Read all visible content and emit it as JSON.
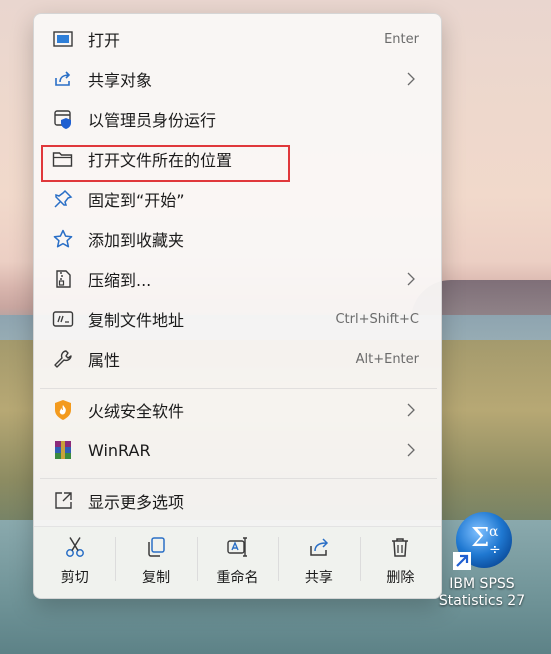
{
  "menu": {
    "items": [
      {
        "label": "打开",
        "shortcut": "Enter",
        "icon": "open-window-icon"
      },
      {
        "label": "共享对象",
        "icon": "share-icon",
        "submenu": true
      },
      {
        "label": "以管理员身份运行",
        "icon": "admin-shield-icon"
      },
      {
        "label": "打开文件所在的位置",
        "icon": "folder-icon",
        "highlighted": true
      },
      {
        "label": "固定到“开始”",
        "icon": "pin-icon"
      },
      {
        "label": "添加到收藏夹",
        "icon": "star-icon"
      },
      {
        "label": "压缩到...",
        "icon": "zip-icon",
        "submenu": true
      },
      {
        "label": "复制文件地址",
        "shortcut": "Ctrl+Shift+C",
        "icon": "copy-path-icon"
      },
      {
        "label": "属性",
        "shortcut": "Alt+Enter",
        "icon": "wrench-icon"
      },
      {
        "label": "火绒安全软件",
        "icon": "huorong-icon",
        "submenu": true
      },
      {
        "label": "WinRAR",
        "icon": "winrar-icon",
        "submenu": true
      },
      {
        "label": "显示更多选项",
        "icon": "more-options-icon"
      }
    ],
    "actions": [
      {
        "label": "剪切",
        "icon": "scissors-icon"
      },
      {
        "label": "复制",
        "icon": "copy-icon"
      },
      {
        "label": "重命名",
        "icon": "rename-icon"
      },
      {
        "label": "共享",
        "icon": "share-icon"
      },
      {
        "label": "删除",
        "icon": "trash-icon"
      }
    ]
  },
  "desktop": {
    "icon_label_line1": "IBM SPSS",
    "icon_label_line2": "Statistics 27"
  },
  "colors": {
    "accent": "#0067c0",
    "highlight_border": "#e0383b"
  }
}
